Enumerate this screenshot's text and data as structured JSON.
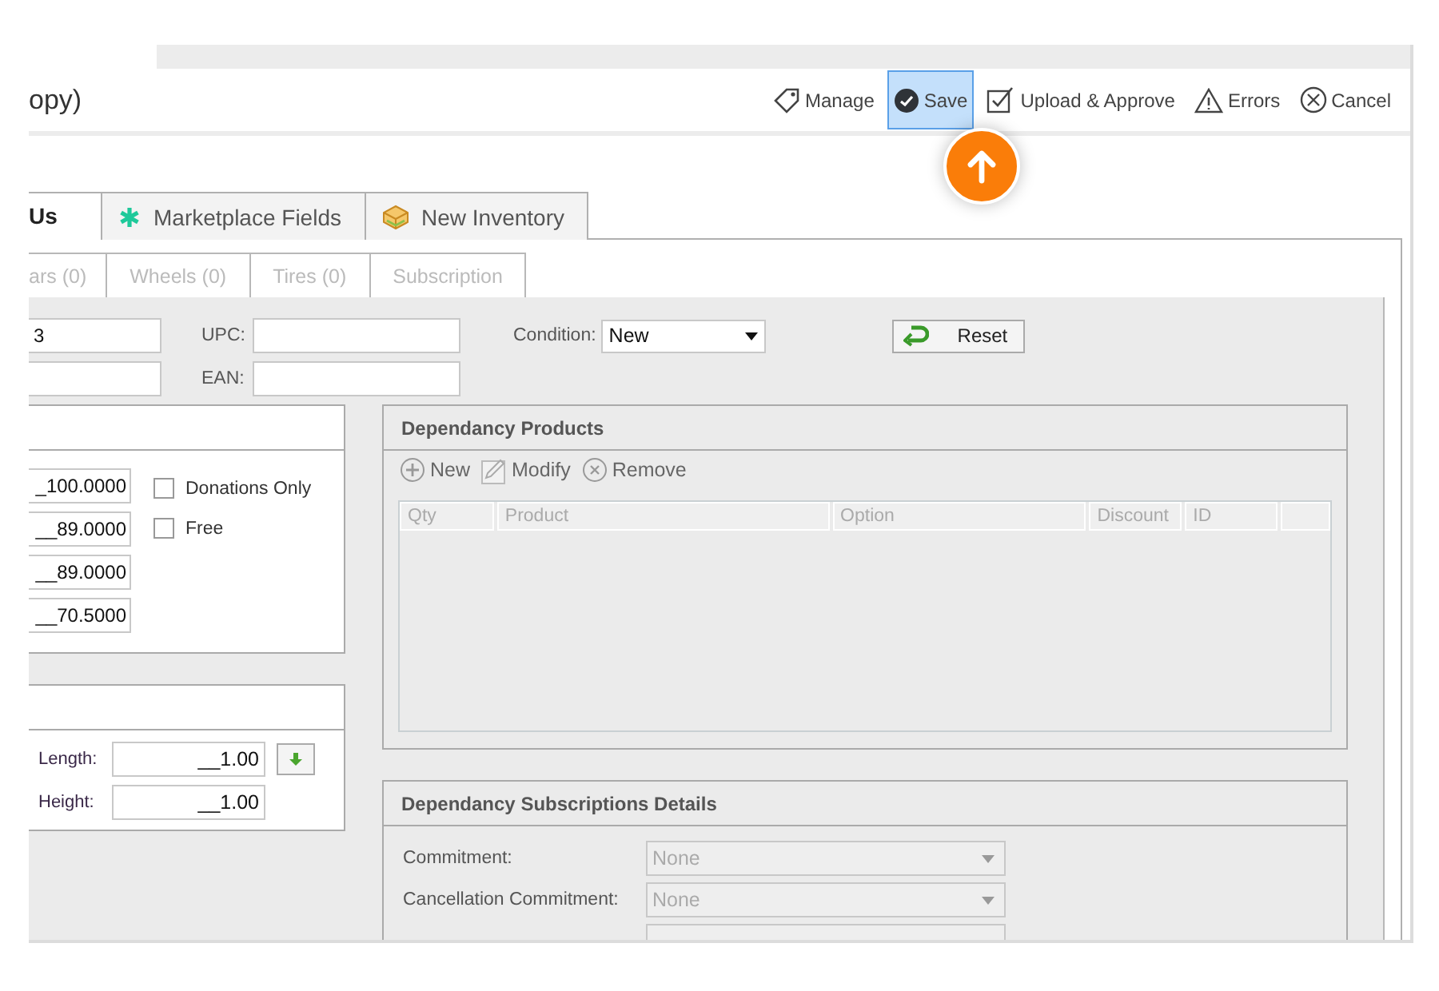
{
  "window": {
    "title": "opy)"
  },
  "toolbar": [
    {
      "label": "Manage",
      "kind": "tag",
      "selected": false
    },
    {
      "label": "Save",
      "kind": "check",
      "selected": true
    },
    {
      "label": "Upload & Approve",
      "kind": "checkbox",
      "selected": false
    },
    {
      "label": "Errors",
      "kind": "warning",
      "selected": false
    },
    {
      "label": "Cancel",
      "kind": "cancel",
      "selected": false
    }
  ],
  "main_tabs": [
    {
      "label": "Us",
      "kind": "plain",
      "selected": true
    },
    {
      "label": "Marketplace Fields",
      "kind": "asterisk",
      "selected": false
    },
    {
      "label": "New Inventory",
      "kind": "box",
      "selected": false
    }
  ],
  "sub_tabs": [
    {
      "label": "ars (0)",
      "selected": false
    },
    {
      "label": "Wheels (0)",
      "selected": false
    },
    {
      "label": "Tires (0)",
      "selected": false
    },
    {
      "label": "Subscription",
      "selected": false
    }
  ],
  "identity": {
    "field_1": "3",
    "upc_label": "UPC:",
    "ean_label": "EAN:",
    "condition": {
      "label": "Condition:",
      "value": "New"
    },
    "reset_button": "Reset"
  },
  "pricing": {
    "values": [
      "_100.0000",
      "__89.0000",
      "__89.0000",
      "__70.5000"
    ],
    "checkboxes": [
      {
        "label": "Donations Only",
        "checked": false
      },
      {
        "label": "Free",
        "checked": false
      }
    ]
  },
  "dependancy_products": {
    "title": "Dependancy Products",
    "actions": [
      {
        "label": "New",
        "kind": "add"
      },
      {
        "label": "Modify",
        "kind": "edit"
      },
      {
        "label": "Remove",
        "kind": "remove"
      }
    ],
    "columns": [
      "Qty",
      "Product",
      "Option",
      "Discount",
      "ID"
    ]
  },
  "dimensions": {
    "fields": [
      {
        "label": "Length:",
        "value": "__1.00"
      },
      {
        "label": "Height:",
        "value": "__1.00"
      }
    ]
  },
  "subscriptions": {
    "title": "Dependancy Subscriptions Details",
    "fields": [
      {
        "label": "Commitment:",
        "value": "None",
        "disabled": true
      },
      {
        "label": "Cancellation Commitment:",
        "value": "None",
        "disabled": true
      }
    ]
  }
}
